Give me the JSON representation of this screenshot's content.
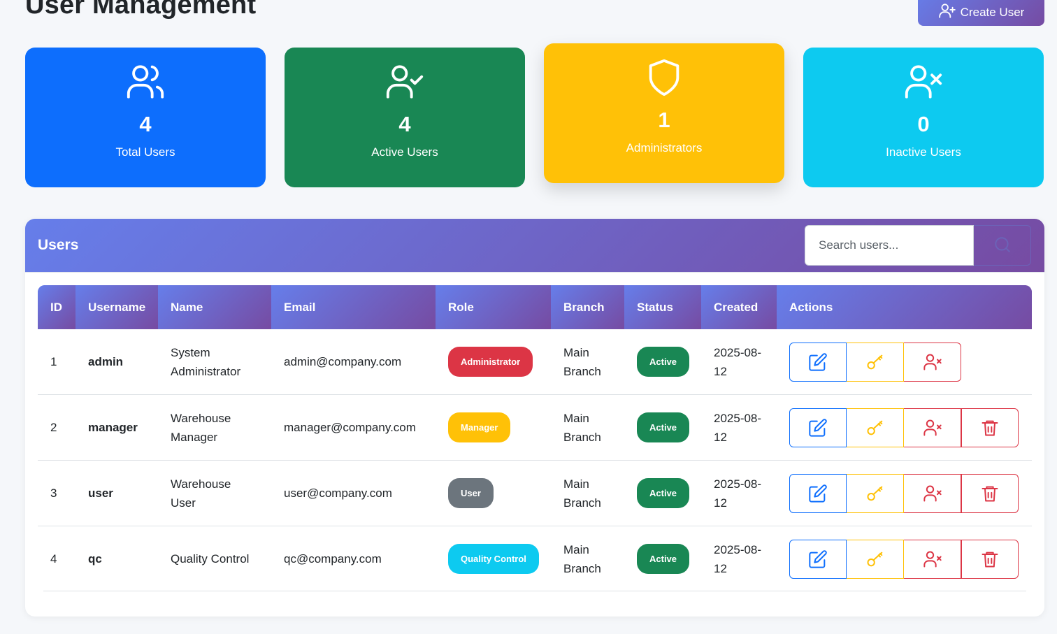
{
  "page": {
    "title": "User Management",
    "create_button": "Create User"
  },
  "stats": {
    "total": {
      "value": "4",
      "label": "Total Users"
    },
    "active": {
      "value": "4",
      "label": "Active Users"
    },
    "admins": {
      "value": "1",
      "label": "Administrators"
    },
    "inactive": {
      "value": "0",
      "label": "Inactive Users"
    }
  },
  "panel": {
    "title": "Users",
    "search_placeholder": "Search users..."
  },
  "table": {
    "headers": [
      "ID",
      "Username",
      "Name",
      "Email",
      "Role",
      "Branch",
      "Status",
      "Created",
      "Actions"
    ],
    "rows": [
      {
        "id": "1",
        "username": "admin",
        "name": "System Administrator",
        "email": "admin@company.com",
        "role": "Administrator",
        "branch": "Main Branch",
        "status": "Active",
        "created": "2025-08-12"
      },
      {
        "id": "2",
        "username": "manager",
        "name": "Warehouse Manager",
        "email": "manager@company.com",
        "role": "Manager",
        "branch": "Main Branch",
        "status": "Active",
        "created": "2025-08-12"
      },
      {
        "id": "3",
        "username": "user",
        "name": "Warehouse User",
        "email": "user@company.com",
        "role": "User",
        "branch": "Main Branch",
        "status": "Active",
        "created": "2025-08-12"
      },
      {
        "id": "4",
        "username": "qc",
        "name": "Quality Control",
        "email": "qc@company.com",
        "role": "Quality Control",
        "branch": "Main Branch",
        "status": "Active",
        "created": "2025-08-12"
      }
    ]
  },
  "colors": {
    "primary": "#0d6efd",
    "success": "#198754",
    "warning": "#ffc107",
    "info": "#0dcaf0",
    "danger": "#dc3545",
    "secondary": "#6c757d",
    "gradient_start": "#667eea",
    "gradient_end": "#764ba2"
  },
  "icons": {
    "stats": [
      "users-icon",
      "user-check-icon",
      "shield-icon",
      "user-x-icon"
    ],
    "actions": [
      "edit-icon",
      "key-icon",
      "user-x-icon",
      "trash-icon"
    ],
    "search": "search-icon",
    "create": "user-plus-icon"
  }
}
